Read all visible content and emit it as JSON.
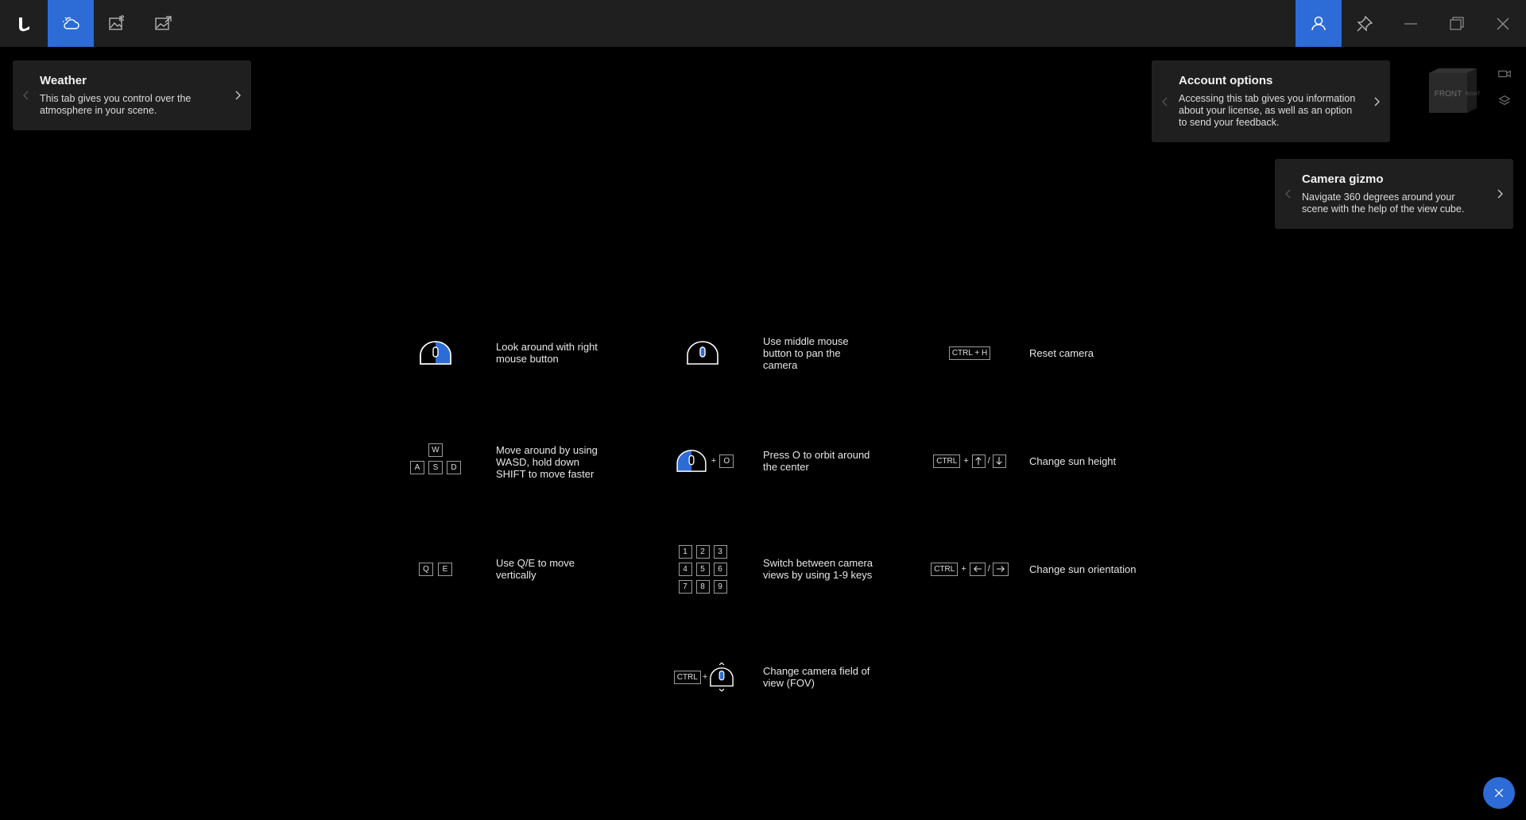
{
  "topbar": {
    "logo_icon": "app-logo-icon",
    "tabs": [
      {
        "name": "weather-tab",
        "icon": "weather-icon",
        "active": true
      },
      {
        "name": "image-settings-tab",
        "icon": "image-settings-icon",
        "active": false
      },
      {
        "name": "export-image-tab",
        "icon": "export-image-icon",
        "active": false
      }
    ],
    "right_buttons": [
      {
        "name": "account-button",
        "icon": "user-icon",
        "active": true
      },
      {
        "name": "pin-button",
        "icon": "pin-icon",
        "active": false
      },
      {
        "name": "minimize-button",
        "icon": "minimize-icon"
      },
      {
        "name": "maximize-button",
        "icon": "maximize-icon"
      },
      {
        "name": "close-window-button",
        "icon": "close-icon"
      }
    ],
    "accent": "#2d6bd6"
  },
  "tips": {
    "weather": {
      "title": "Weather",
      "text_1": "This tab gives you control over the",
      "text_2": "atmosphere in your scene."
    },
    "account": {
      "title": "Account options",
      "text_1": "Accessing this tab gives you information",
      "text_2": "about your license, as well as an option",
      "text_3": "to send your feedback."
    },
    "camera_gizmo": {
      "title": "Camera gizmo",
      "text_1": "Navigate 360 degrees around your",
      "text_2": "scene with the help of the view cube."
    }
  },
  "viewcube": {
    "front_label": "FRONT",
    "side_label": "RIGHT"
  },
  "shortcuts": {
    "look_around": {
      "line_1": "Look around with right",
      "line_2": "mouse button"
    },
    "pan": {
      "line_1": "Use middle mouse",
      "line_2": "button to pan the",
      "line_3": "camera"
    },
    "reset": {
      "key": "CTRL + H",
      "line_1": "Reset camera"
    },
    "move": {
      "keys": [
        "W",
        "A",
        "S",
        "D"
      ],
      "line_1": "Move around by using",
      "line_2": "WASD, hold down",
      "line_3": "SHIFT to move faster"
    },
    "orbit": {
      "plus": "+",
      "key": "O",
      "line_1": "Press O to orbit around",
      "line_2": "the center"
    },
    "sun_height": {
      "key": "CTRL",
      "plus": "+",
      "slash": "/",
      "line_1": "Change sun height"
    },
    "vertical": {
      "keys": [
        "Q",
        "E"
      ],
      "line_1": "Use Q/E to move",
      "line_2": "vertically"
    },
    "views": {
      "keys": [
        "1",
        "2",
        "3",
        "4",
        "5",
        "6",
        "7",
        "8",
        "9"
      ],
      "line_1": "Switch between camera",
      "line_2": "views by using 1-9 keys"
    },
    "sun_orientation": {
      "key": "CTRL",
      "plus": "+",
      "slash": "/",
      "line_1": "Change sun orientation"
    },
    "fov": {
      "key": "CTRL",
      "plus": "+",
      "line_1": "Change camera field of",
      "line_2": "view (FOV)"
    }
  },
  "close_overlay_icon": "close-icon"
}
